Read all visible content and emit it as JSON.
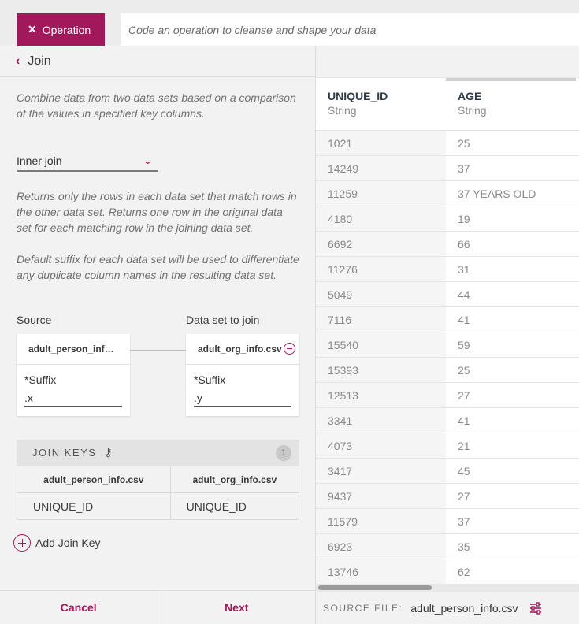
{
  "topbar": {
    "operation_label": "Operation",
    "code_placeholder": "Code an operation to cleanse and shape your data"
  },
  "panel": {
    "breadcrumb": "Join",
    "description": "Combine data from two data sets based on a comparison of the values in specified key columns.",
    "join_type": "Inner join",
    "join_type_description": "Returns only the rows in each data set that match rows in the other data set. Returns one row in the original data set for each matching row in the joining data set.",
    "suffix_description": "Default suffix for each data set will be used to differentiate any duplicate column names in the resulting data set.",
    "source_label": "Source",
    "join_label": "Data set to join",
    "source_card": {
      "name": "adult_person_inf…",
      "suffix_label": "*Suffix",
      "suffix_value": ".x"
    },
    "join_card": {
      "name": "adult_org_info.csv",
      "suffix_label": "*Suffix",
      "suffix_value": ".y"
    },
    "join_keys": {
      "title": "JOIN KEYS",
      "count": "1",
      "headers": [
        "adult_person_info.csv",
        "adult_org_info.csv"
      ],
      "rows": [
        [
          "UNIQUE_ID",
          "UNIQUE_ID"
        ]
      ]
    },
    "add_join_key": "Add Join Key",
    "cancel": "Cancel",
    "next": "Next"
  },
  "preview": {
    "columns": [
      {
        "name": "UNIQUE_ID",
        "type": "String"
      },
      {
        "name": "AGE",
        "type": "String"
      }
    ],
    "rows": [
      [
        "1021",
        "25"
      ],
      [
        "14249",
        "37"
      ],
      [
        "11259",
        "37 YEARS OLD"
      ],
      [
        "4180",
        "19"
      ],
      [
        "6692",
        "66"
      ],
      [
        "11276",
        "31"
      ],
      [
        "5049",
        "44"
      ],
      [
        "7116",
        "41"
      ],
      [
        "15540",
        "59"
      ],
      [
        "15393",
        "25"
      ],
      [
        "12513",
        "27"
      ],
      [
        "3341",
        "41"
      ],
      [
        "4073",
        "21"
      ],
      [
        "3417",
        "45"
      ],
      [
        "9437",
        "27"
      ],
      [
        "11579",
        "37"
      ],
      [
        "6923",
        "35"
      ],
      [
        "13746",
        "62"
      ]
    ],
    "source_file_label": "SOURCE FILE:",
    "source_file_name": "adult_person_info.csv"
  },
  "colors": {
    "accent": "#a2195b"
  }
}
